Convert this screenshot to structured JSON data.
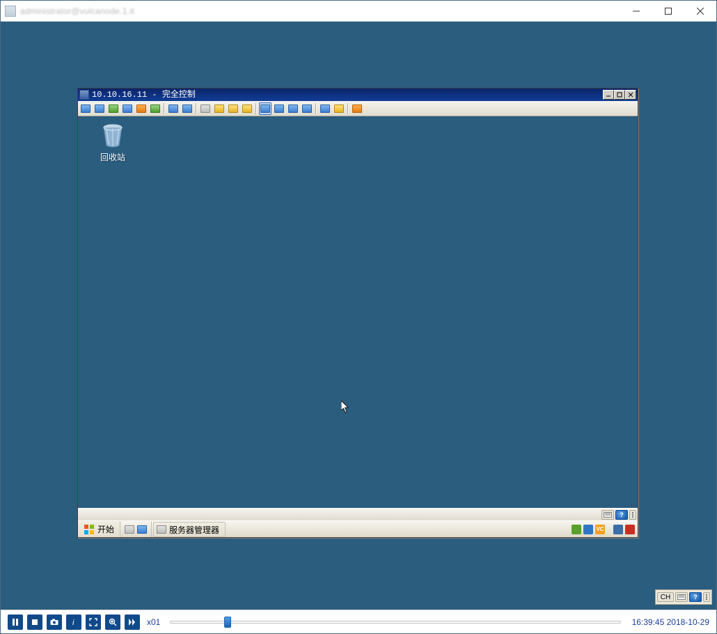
{
  "outer": {
    "title": "administrator@vulcanode.1.it"
  },
  "inner": {
    "title": "10.10.16.11 - 完全控制",
    "desktop": {
      "recycle_bin": "回收站"
    },
    "taskbar": {
      "start": "开始",
      "task_label": "服务器管理器"
    }
  },
  "float": {
    "lang": "CH"
  },
  "playbar": {
    "speed": "x01",
    "timestamp": "16:39:45 2018-10-29"
  }
}
